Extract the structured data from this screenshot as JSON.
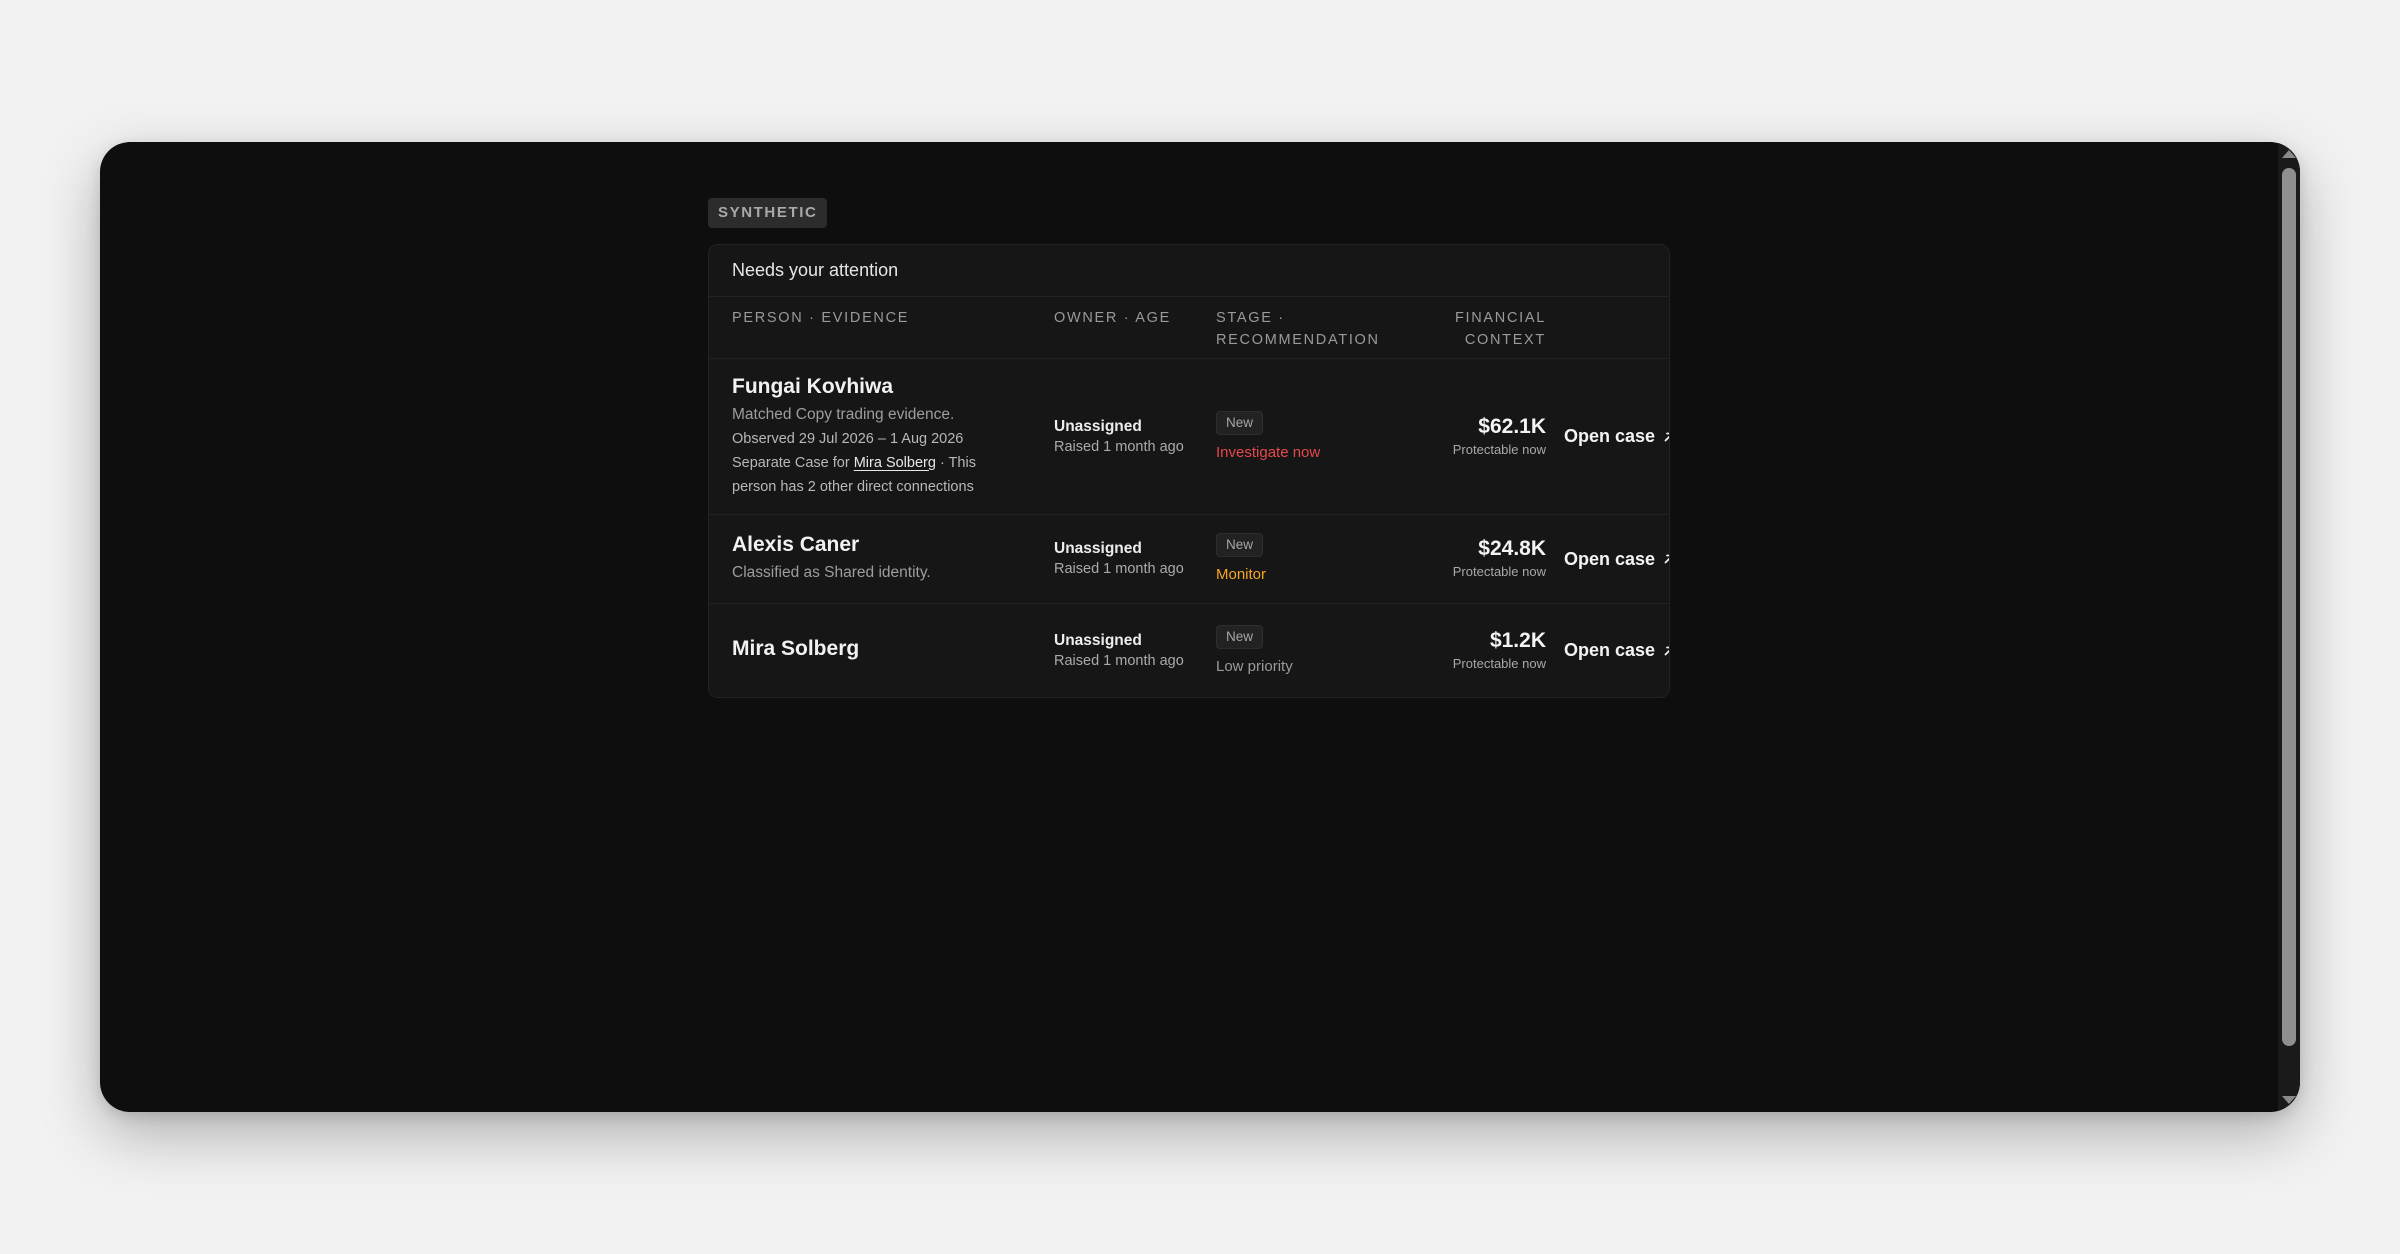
{
  "badge": "SYNTHETIC",
  "panel": {
    "title": "Needs your attention"
  },
  "columns": {
    "person": "PERSON · EVIDENCE",
    "owner": "OWNER · AGE",
    "stage_line1": "STAGE ·",
    "stage_line2": "RECOMMENDATION",
    "financial_line1": "FINANCIAL",
    "financial_line2": "CONTEXT"
  },
  "rows": [
    {
      "name": "Fungai Kovhiwa",
      "evidence": "Matched Copy trading evidence.",
      "observed": "Observed 29 Jul 2026 – 1 Aug 2026",
      "separate_prefix": "Separate Case for",
      "separate_link": "Mira Solberg",
      "separate_suffix": " · This",
      "connections": "person has 2 other direct connections",
      "owner": "Unassigned",
      "age": "Raised 1 month ago",
      "stage": "New",
      "recommendation": "Investigate now",
      "recommendation_color": "#e5484d",
      "amount": "$62.1K",
      "amount_note": "Protectable now",
      "action": "Open case"
    },
    {
      "name": "Alexis Caner",
      "evidence": "Classified as Shared identity.",
      "owner": "Unassigned",
      "age": "Raised 1 month ago",
      "stage": "New",
      "recommendation": "Monitor",
      "recommendation_color": "#f5a623",
      "amount": "$24.8K",
      "amount_note": "Protectable now",
      "action": "Open case"
    },
    {
      "name": "Mira Solberg",
      "owner": "Unassigned",
      "age": "Raised 1 month ago",
      "stage": "New",
      "recommendation": "Low priority",
      "recommendation_color": "#9a9a9a",
      "amount": "$1.2K",
      "amount_note": "Protectable now",
      "action": "Open case"
    }
  ],
  "icons": {
    "action": "arrow-up-right-icon"
  }
}
